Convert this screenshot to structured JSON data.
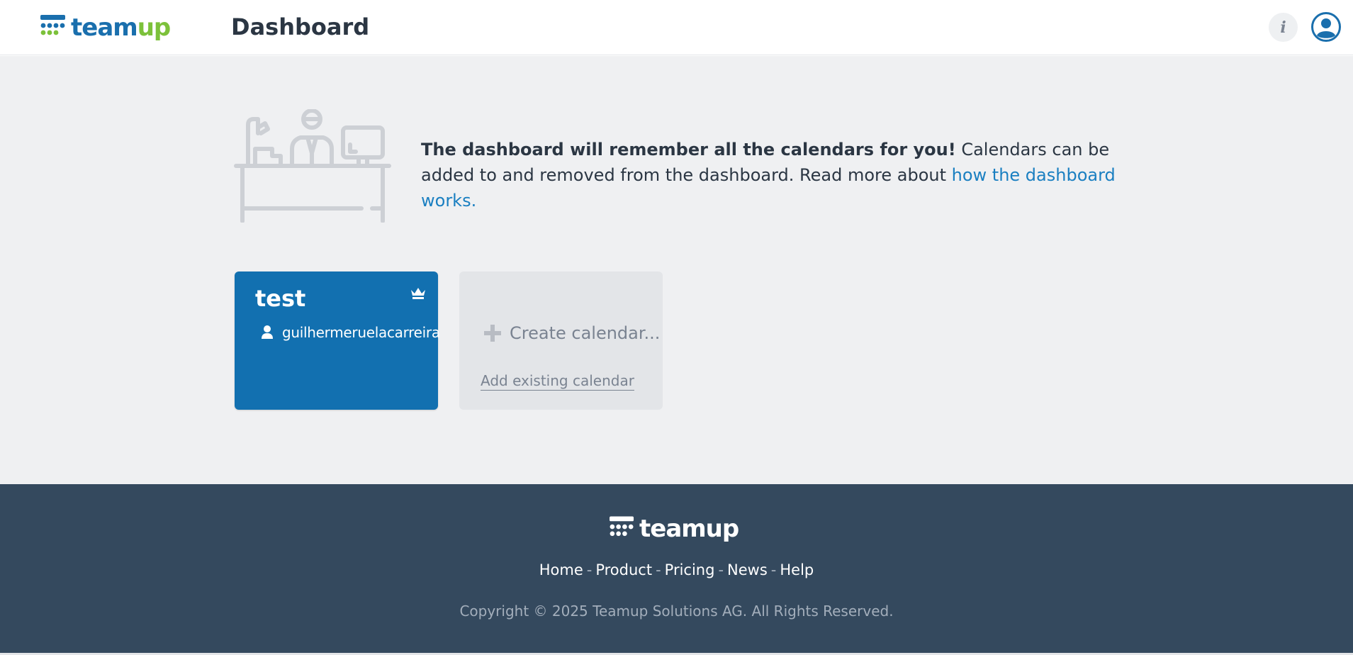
{
  "header": {
    "logo": {
      "team": "team",
      "up": "up"
    },
    "page_title": "Dashboard",
    "info_label": "i"
  },
  "intro": {
    "bold_text": "The dashboard will remember all the calendars for you!",
    "text": " Calendars can be added to and removed from the dashboard. Read more about ",
    "link_text": "how the dashboard works."
  },
  "calendars": [
    {
      "name": "test",
      "owner": "guilhermeruelacarreira"
    }
  ],
  "new_calendar": {
    "create_label": "Create calendar...",
    "add_existing_label": "Add existing calendar"
  },
  "footer": {
    "logo_text": "teamup",
    "nav": [
      "Home",
      "Product",
      "Pricing",
      "News",
      "Help"
    ],
    "separator": "-",
    "copyright": "Copyright © 2025 Teamup Solutions AG. All Rights Reserved."
  },
  "colors": {
    "brand_blue": "#1a6fad",
    "brand_green": "#7cc13a",
    "card_blue": "#1270b0",
    "footer_bg": "#34495e",
    "link": "#1a7fc1"
  }
}
